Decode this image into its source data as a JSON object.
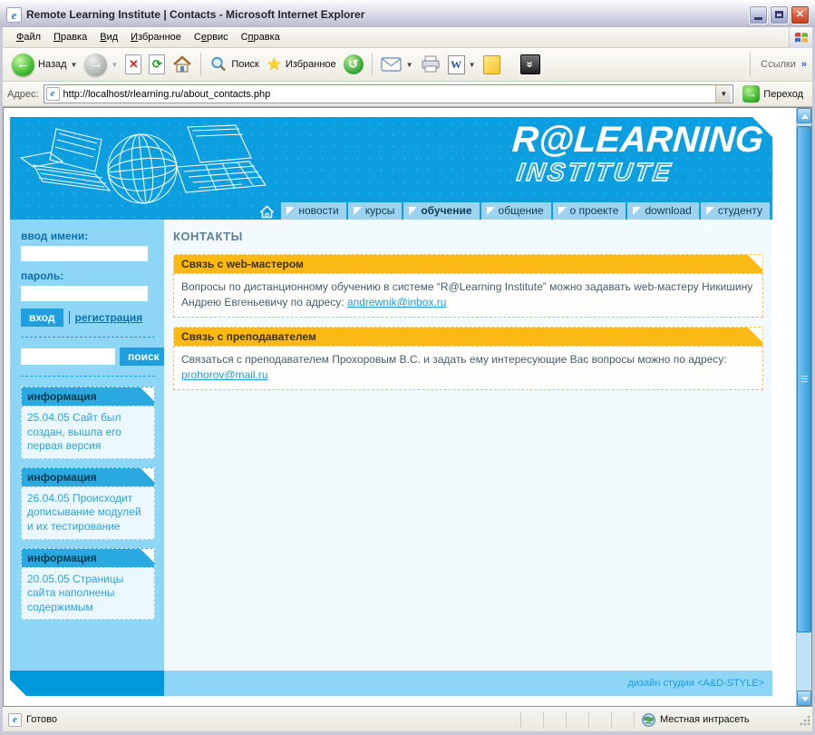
{
  "window": {
    "title": "Remote Learning Institute | Contacts - Microsoft Internet Explorer"
  },
  "menu_bar": {
    "items": [
      {
        "pre": "",
        "u": "Ф",
        "rest": "айл"
      },
      {
        "pre": "",
        "u": "П",
        "rest": "равка"
      },
      {
        "pre": "",
        "u": "В",
        "rest": "ид"
      },
      {
        "pre": "",
        "u": "И",
        "rest": "збранное"
      },
      {
        "pre": "С",
        "u": "е",
        "rest": "рвис"
      },
      {
        "pre": "С",
        "u": "п",
        "rest": "равка"
      }
    ]
  },
  "toolbar": {
    "back_label": "Назад",
    "search_label": "Поиск",
    "favorites_label": "Избранное",
    "links_label": "Ссылки"
  },
  "address_bar": {
    "label": "Адрес:",
    "url": "http://localhost/rlearning.ru/about_contacts.php",
    "go_label": "Переход"
  },
  "site_header": {
    "logo_line1": "R@LEARNING",
    "logo_line2": "INSTITUTE"
  },
  "nav": {
    "tabs": [
      {
        "label": "новости"
      },
      {
        "label": "курсы"
      },
      {
        "label": "обучение"
      },
      {
        "label": "общение"
      },
      {
        "label": "о проекте"
      },
      {
        "label": "download"
      },
      {
        "label": "студенту"
      }
    ]
  },
  "sidebar": {
    "login_label": "ввод имени:",
    "password_label": "пароль:",
    "login_button": "вход",
    "register_link": "регистрация",
    "search_button": "поиск",
    "info_blocks": [
      {
        "title": "информация",
        "text": "25.04.05 Сайт был создан, вышла его первая версия"
      },
      {
        "title": "информация",
        "text": "26.04.05 Происходит дописывание модулей и их тестирование"
      },
      {
        "title": "информация",
        "text": "20.05.05 Страницы сайта наполнены содержимым"
      }
    ]
  },
  "main": {
    "heading": "КОНТАКТЫ",
    "sections": [
      {
        "title": "Связь с web-мастером",
        "text": "Вопросы по дистанционному обучению в системе “R@Learning Institute” можно задавать web-мастеру Никишину Андрею Евгеньевичу по адресу: ",
        "link": "andrewnik@inbox.ru"
      },
      {
        "title": "Связь с преподавателем",
        "text": "Связаться с преподавателем Прохоровым В.С. и задать ему интересующие Вас вопросы можно по адресу: ",
        "link": "prohorov@mail.ru"
      }
    ]
  },
  "page_footer": {
    "credit": "дизайн студии <A&D-STYLE>"
  },
  "status_bar": {
    "status": "Готово",
    "zone": "Местная интрасеть"
  },
  "colors": {
    "header_blue": "#0d9ee0",
    "sidebar_blue": "#8ed6f6",
    "tab_blue": "#9dd3ee",
    "accent_yellow": "#fbb915",
    "link_blue": "#1b9de2",
    "footer_blue": "#0098da"
  }
}
